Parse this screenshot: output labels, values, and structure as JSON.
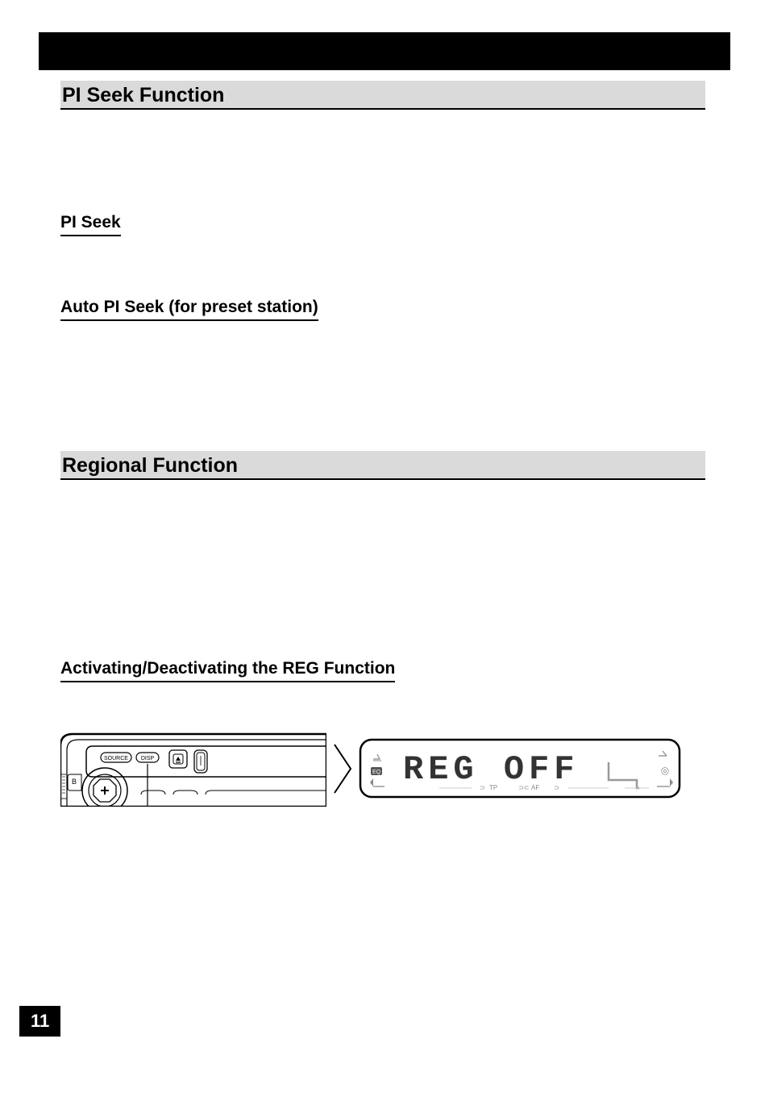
{
  "headings": {
    "pi_seek_function": "PI Seek Function",
    "pi_seek": "PI Seek",
    "auto_pi_seek": "Auto PI Seek (for preset station)",
    "regional_function": "Regional Function",
    "activating_reg": "Activating/Deactivating the REG Function"
  },
  "device": {
    "source_label": "SOURCE",
    "disp_label": "DISP"
  },
  "display": {
    "main_text": "REG  OFF",
    "eq_label": "EQ",
    "tp_label": "TP",
    "af_label": "AF",
    "signal_icon": "signal",
    "stereo_icon": "stereo"
  },
  "page_number": "11"
}
